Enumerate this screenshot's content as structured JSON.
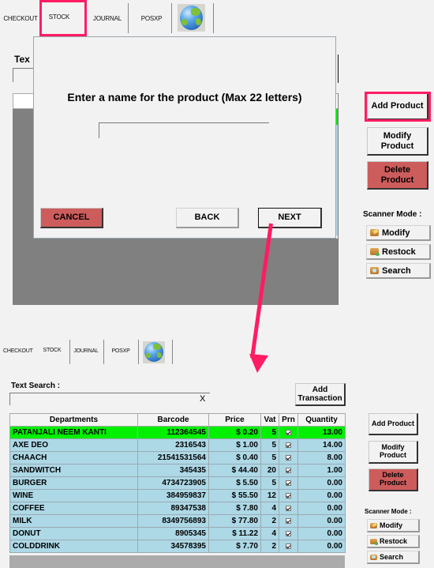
{
  "tabs": [
    {
      "label": "CHECKOUT"
    },
    {
      "label": "STOCK",
      "active": true
    },
    {
      "label": "JOURNAL"
    },
    {
      "label": "POSXP"
    },
    {
      "label": "",
      "icon": "globe-icon"
    }
  ],
  "top_view": {
    "text_search_label_partial": "Tex",
    "dialog": {
      "prompt": "Enter a name for the product (Max 22 letters)",
      "name_input_value": "",
      "cancel_label": "CANCEL",
      "back_label": "BACK",
      "next_label": "NEXT"
    },
    "side_buttons": {
      "add_product": "Add Product",
      "modify_product": "Modify Product",
      "delete_product": "Delete Product"
    },
    "scanner_mode": {
      "label": "Scanner Mode :",
      "modify": "Modify",
      "restock": "Restock",
      "search": "Search"
    }
  },
  "bottom_view": {
    "text_search_label": "Text Search :",
    "text_search_value": "",
    "clear_label": "X",
    "add_transaction_label": "Add Transaction",
    "table": {
      "columns": [
        "Departments",
        "Barcode",
        "Price",
        "Vat",
        "Prn",
        "Quantity"
      ],
      "rows": [
        {
          "department": "PATANJALI NEEM KANTI",
          "barcode": "112364545",
          "price": "$ 0.20",
          "vat": "5",
          "prn": true,
          "quantity": "13.00",
          "selected": true
        },
        {
          "department": "AXE DEO",
          "barcode": "2316543",
          "price": "$ 1.00",
          "vat": "5",
          "prn": true,
          "quantity": "14.00"
        },
        {
          "department": "CHAACH",
          "barcode": "21541531564",
          "price": "$ 0.40",
          "vat": "5",
          "prn": true,
          "quantity": "8.00"
        },
        {
          "department": "SANDWITCH",
          "barcode": "345435",
          "price": "$ 44.40",
          "vat": "20",
          "prn": true,
          "quantity": "1.00"
        },
        {
          "department": "BURGER",
          "barcode": "4734723905",
          "price": "$ 5.50",
          "vat": "5",
          "prn": true,
          "quantity": "0.00"
        },
        {
          "department": "WINE",
          "barcode": "384959837",
          "price": "$ 55.50",
          "vat": "12",
          "prn": true,
          "quantity": "0.00"
        },
        {
          "department": "COFFEE",
          "barcode": "89347538",
          "price": "$ 7.80",
          "vat": "4",
          "prn": true,
          "quantity": "0.00"
        },
        {
          "department": "MILK",
          "barcode": "8349756893",
          "price": "$ 77.80",
          "vat": "2",
          "prn": true,
          "quantity": "0.00"
        },
        {
          "department": "DONUT",
          "barcode": "8905345",
          "price": "$ 11.22",
          "vat": "4",
          "prn": true,
          "quantity": "0.00"
        },
        {
          "department": "COLDDRINK",
          "barcode": "34578395",
          "price": "$ 7.70",
          "vat": "2",
          "prn": true,
          "quantity": "0.00"
        }
      ]
    },
    "side_buttons": {
      "add_product": "Add Product",
      "modify_product": "Modify Product",
      "delete_product": "Delete Product"
    },
    "scanner_mode": {
      "label": "Scanner Mode :",
      "modify": "Modify",
      "restock": "Restock",
      "search": "Search"
    }
  },
  "colors": {
    "highlight": "#ff1c63",
    "delete_red": "#cd5c5c",
    "row_blue": "#add8e6",
    "row_selected": "#00f000",
    "grid_grey": "#808080"
  }
}
